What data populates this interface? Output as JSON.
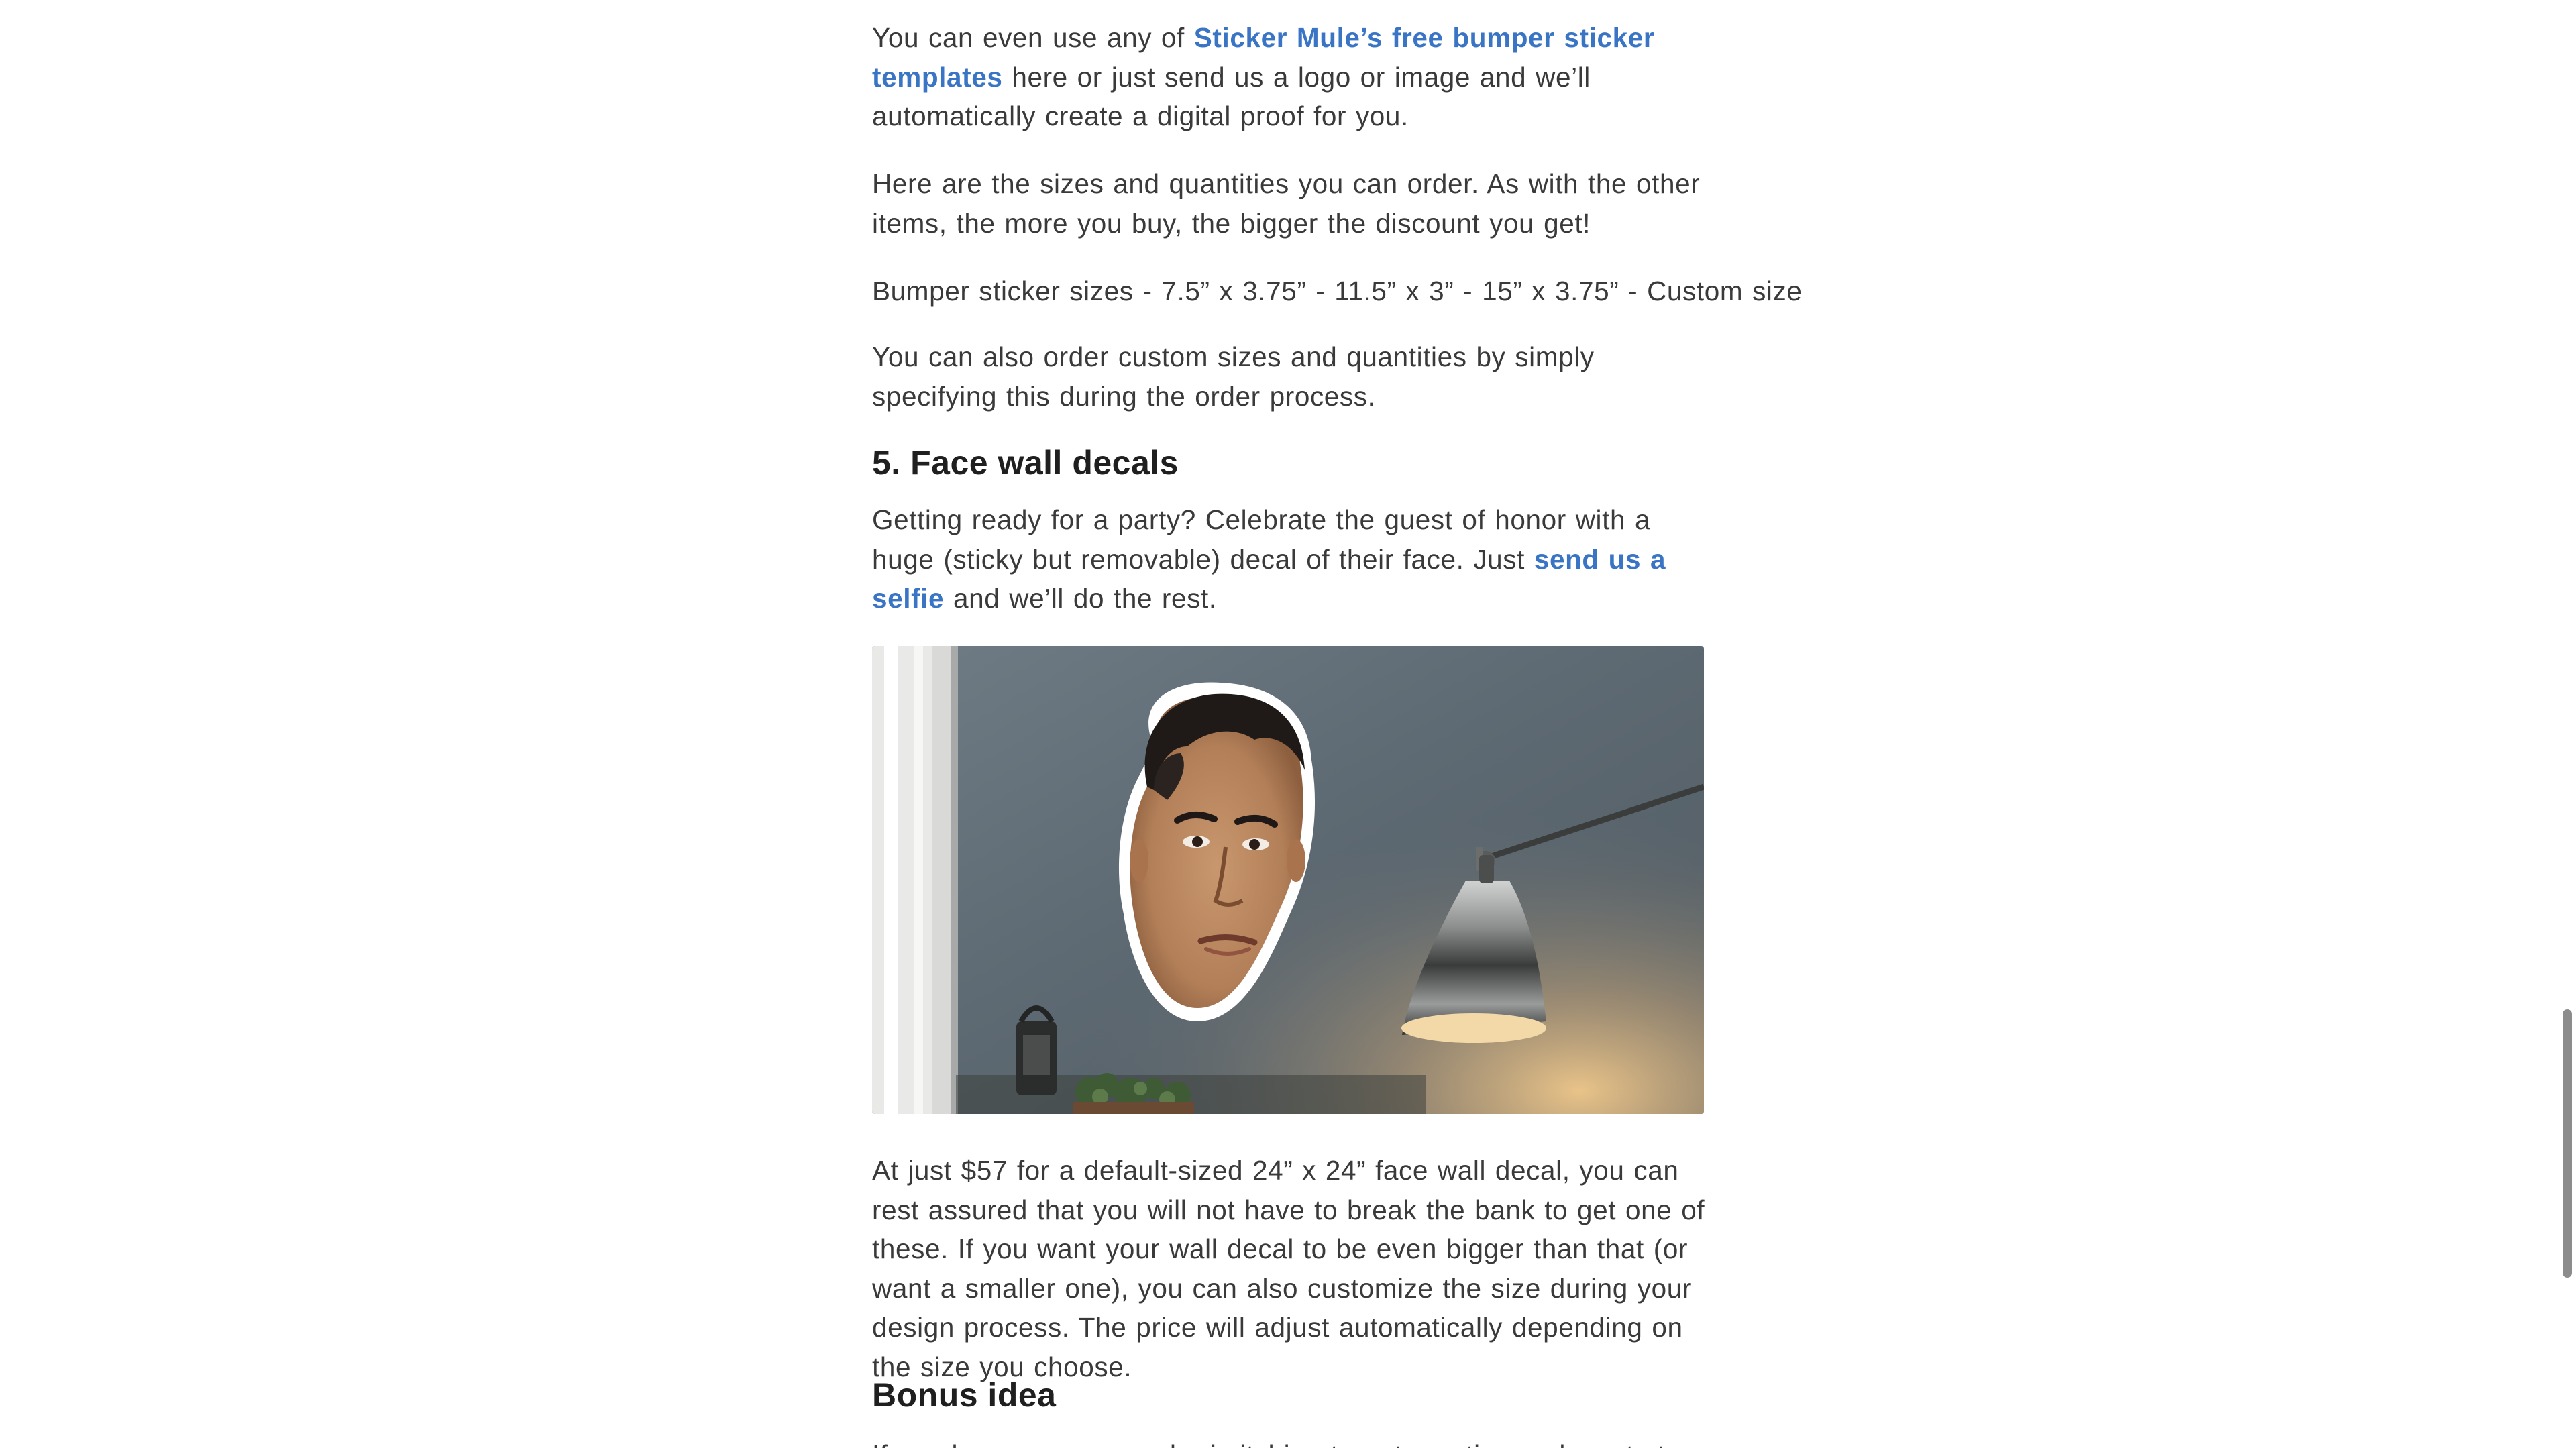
{
  "article": {
    "p1": {
      "before": "You can even use any of ",
      "link": "Sticker Mule’s free bumper sticker templates",
      "after": " here or just send us a logo or image and we’ll automatically create a digital proof for you."
    },
    "p2": "Here are the sizes and quantities you can order. As with the other items, the more you buy, the bigger the discount you get!",
    "p3": "Bumper sticker sizes - 7.5” x 3.75” - 11.5” x 3” - 15” x 3.75” - Custom size",
    "p4": "You can also order custom sizes and quantities by simply specifying this during the order process.",
    "heading_face": "5. Face wall decals",
    "p5": {
      "before": "Getting ready for a party? Celebrate the guest of honor with a huge (sticky but removable) decal of their face. Just ",
      "link": "send us a selfie",
      "after": " and we’ll do the rest."
    },
    "p6": "At just $57 for a default-sized 24” x 24” face wall decal, you can rest assured that you will not have to break the bank to get one of these. If you want your wall decal to be even bigger than that (or want a smaller one), you can also customize the size during your design process. The price will adjust automatically depending on the size you choose.",
    "heading_bonus": "Bonus idea",
    "p7": "If you know someone who is itching to get creative and wants to make"
  },
  "colors": {
    "link": "#3975c4",
    "text": "#3a3a3a",
    "heading": "#1f1f1f"
  }
}
